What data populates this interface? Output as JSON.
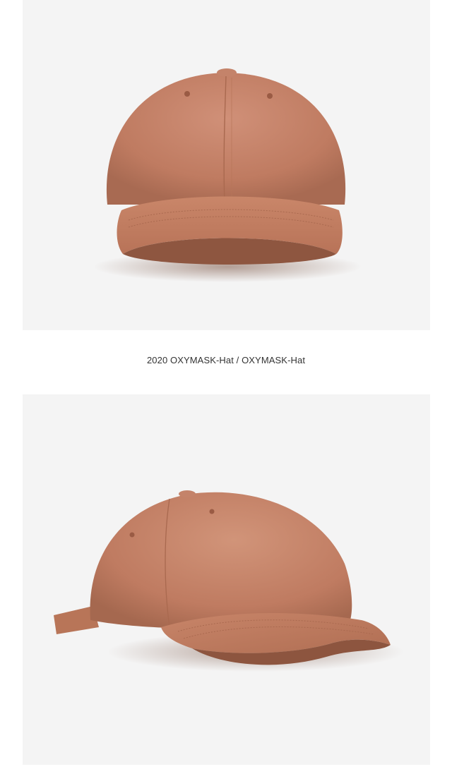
{
  "caption": "2020 OXYMASK-Hat / OXYMASK-Hat",
  "colors": {
    "background": "#ffffff",
    "panel": "#f4f4f4",
    "hat_main": "#c07c62",
    "hat_shadow": "#9d5f48",
    "hat_highlight": "#d29277",
    "brim_under": "#a4654d",
    "caption_text": "#333333"
  },
  "images": [
    {
      "name": "hat-front-photo",
      "subject": "baseball cap, front view"
    },
    {
      "name": "hat-side-photo",
      "subject": "baseball cap, side view"
    }
  ]
}
